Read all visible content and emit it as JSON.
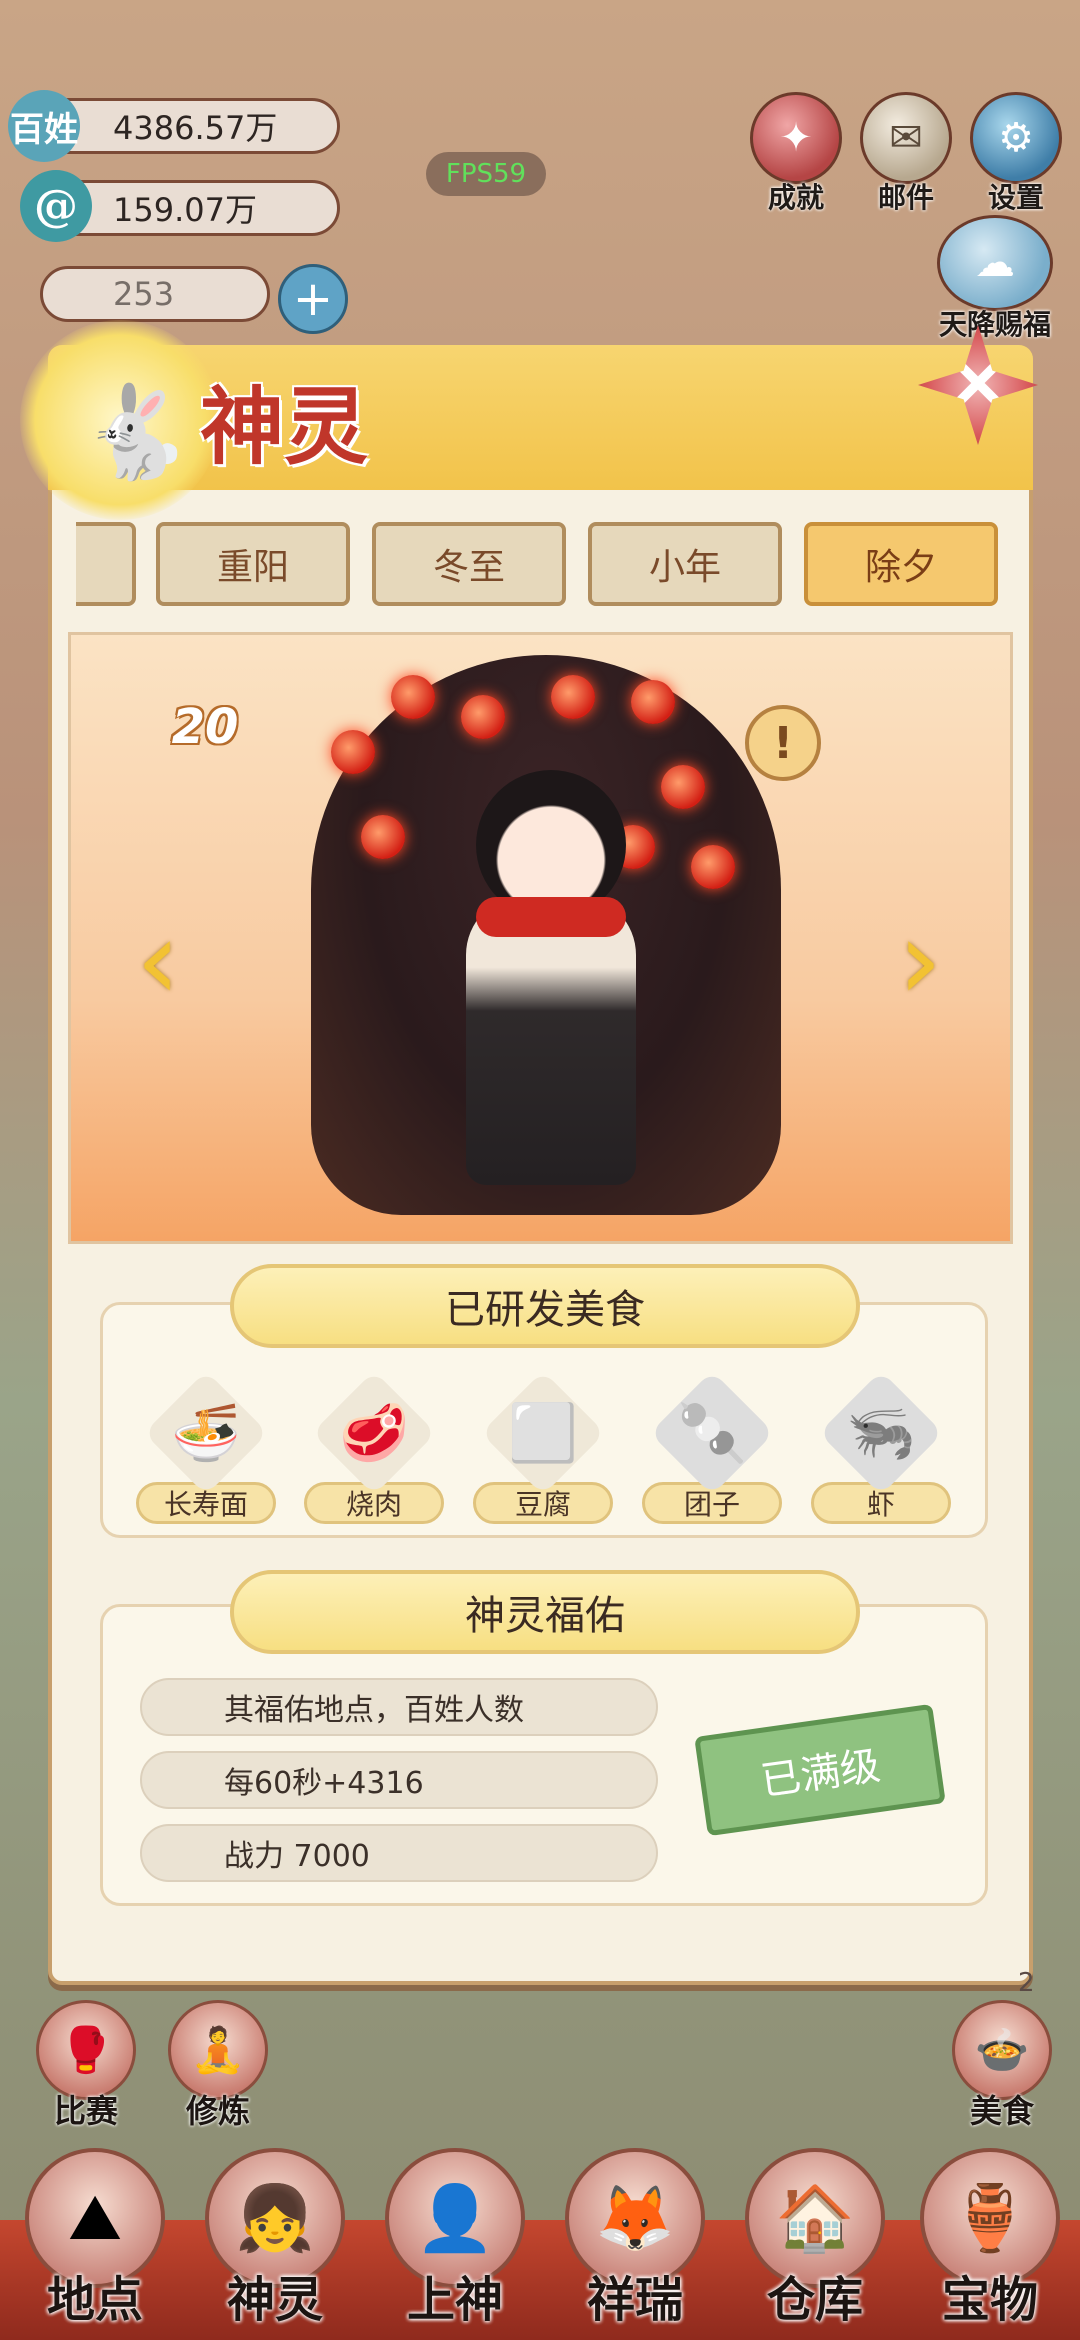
{
  "hud": {
    "resources": [
      {
        "label": "百姓",
        "value": "4386.57万"
      },
      {
        "label": "",
        "value": "159.07万"
      },
      {
        "label": "",
        "value": "253"
      }
    ],
    "fps": "FPS59",
    "top_buttons": [
      {
        "label": "成就",
        "icon": "achievement-icon"
      },
      {
        "label": "邮件",
        "icon": "mail-icon"
      },
      {
        "label": "设置",
        "icon": "gear-icon"
      }
    ],
    "blessing_button": "天降赐福",
    "side_number": "2"
  },
  "panel": {
    "title": "神灵",
    "tabs": [
      {
        "label": "",
        "active": false
      },
      {
        "label": "重阳",
        "active": false
      },
      {
        "label": "冬至",
        "active": false
      },
      {
        "label": "小年",
        "active": false
      },
      {
        "label": "除夕",
        "active": true
      }
    ],
    "character": {
      "level": "20",
      "info_icon": "!"
    },
    "food_section": {
      "title": "已研发美食",
      "items": [
        {
          "name": "长寿面",
          "glyph": "🍜"
        },
        {
          "name": "烧肉",
          "glyph": "🥩"
        },
        {
          "name": "豆腐",
          "glyph": "⬜"
        },
        {
          "name": "团子",
          "glyph": "🍡"
        },
        {
          "name": "虾",
          "glyph": "🦐"
        }
      ]
    },
    "blessing_section": {
      "title": "神灵福佑",
      "stats": [
        "其福佑地点，百姓人数",
        "每60秒+4316",
        "战力 7000"
      ],
      "status_stamp": "已满级"
    }
  },
  "side_buttons": [
    {
      "label": "比赛"
    },
    {
      "label": "修炼"
    },
    {
      "label": "美食"
    }
  ],
  "bottom_nav": [
    {
      "label": "地点",
      "glyph": "⛰"
    },
    {
      "label": "神灵",
      "glyph": "👧"
    },
    {
      "label": "上神",
      "glyph": "👤"
    },
    {
      "label": "祥瑞",
      "glyph": "🦊"
    },
    {
      "label": "仓库",
      "glyph": "🏠"
    },
    {
      "label": "宝物",
      "glyph": "🏺"
    }
  ],
  "colors": {
    "accent": "#c0362a",
    "panel_bg": "#f7f1e2",
    "tab_active": "#f5c86e",
    "maxed_stamp": "#8fc280"
  }
}
